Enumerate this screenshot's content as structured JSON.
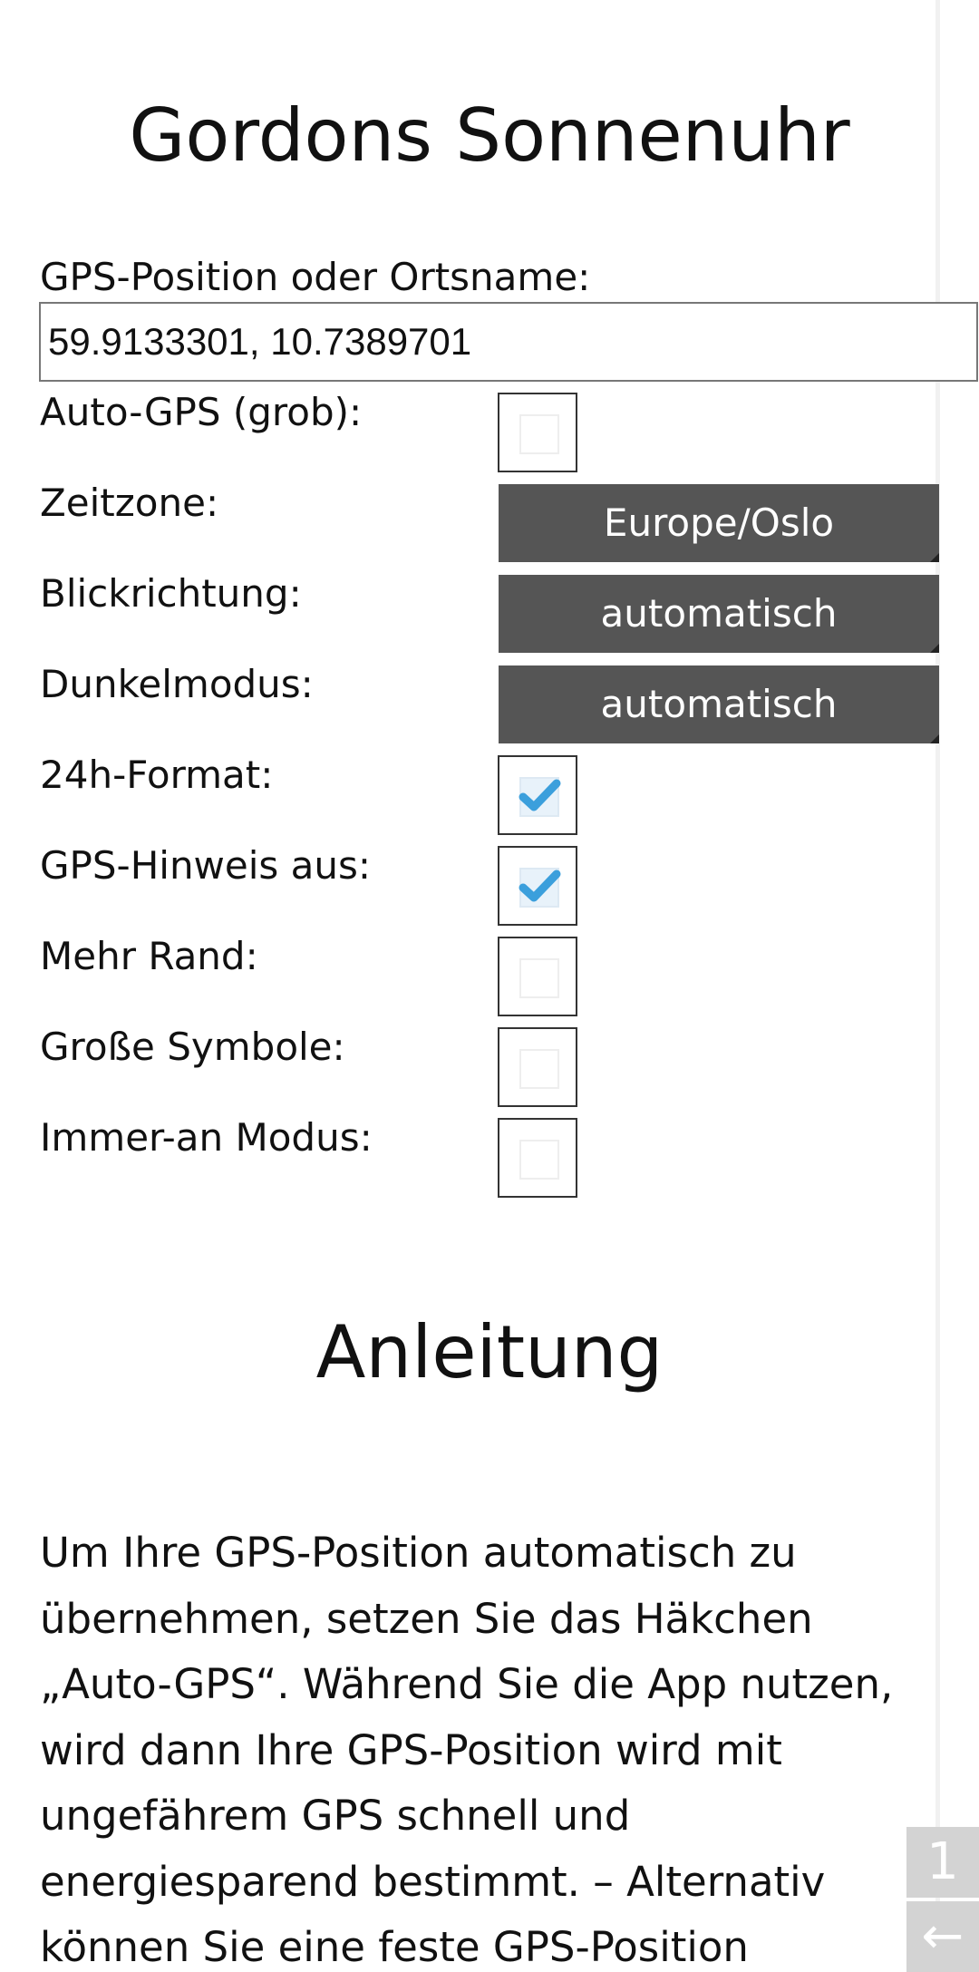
{
  "app": {
    "title": "Gordons Sonnenuhr"
  },
  "settings": {
    "gps_label": "GPS-Position oder Ortsname:",
    "gps_value": "59.9133301, 10.7389701",
    "rows": [
      {
        "label": "Auto-GPS (grob):",
        "type": "checkbox",
        "checked": false
      },
      {
        "label": "Zeitzone:",
        "type": "select",
        "value": "Europe/Oslo"
      },
      {
        "label": "Blickrichtung:",
        "type": "select",
        "value": "automatisch"
      },
      {
        "label": "Dunkelmodus:",
        "type": "select",
        "value": "automatisch"
      },
      {
        "label": "24h-Format:",
        "type": "checkbox",
        "checked": true
      },
      {
        "label": "GPS-Hinweis aus:",
        "type": "checkbox",
        "checked": true
      },
      {
        "label": "Mehr Rand:",
        "type": "checkbox",
        "checked": false
      },
      {
        "label": "Große Symbole:",
        "type": "checkbox",
        "checked": false
      },
      {
        "label": "Immer-an Modus:",
        "type": "checkbox",
        "checked": false
      }
    ]
  },
  "instructions": {
    "title": "Anleitung",
    "lines": [
      "Um Ihre GPS-Position automatisch zu",
      "übernehmen, setzen Sie das Häkchen",
      "„Auto-GPS“. Während Sie die App nutzen,",
      "wird dann Ihre GPS-Position wird mit",
      "ungefährem GPS schnell und",
      "energiesparend bestimmt. – Alternativ",
      "können Sie eine feste GPS-Position"
    ]
  },
  "nav": {
    "page_number": "1",
    "back_icon": "←"
  },
  "colors": {
    "select_bg": "#555555",
    "check_color": "#3b9fdc",
    "nav_bg": "#d3d3d3"
  }
}
